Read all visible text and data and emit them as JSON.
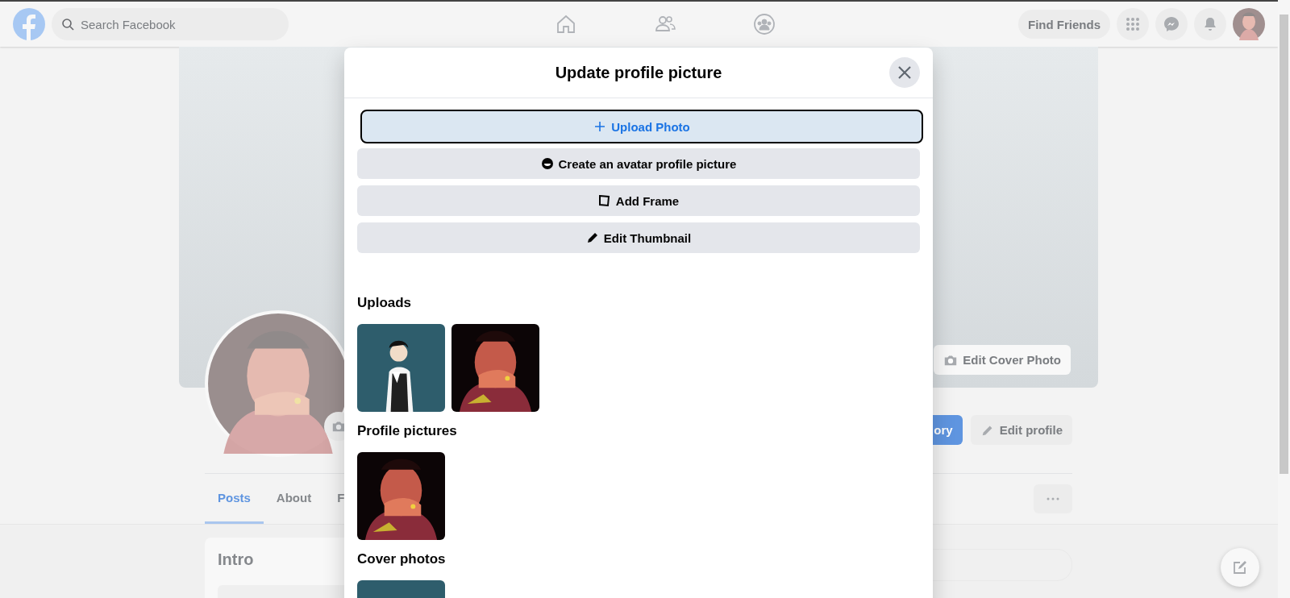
{
  "nav": {
    "search": {
      "placeholder": "Search Facebook"
    },
    "find_friends": "Find Friends"
  },
  "profile": {
    "edit_cover": "Edit Cover Photo",
    "story_button": "ory",
    "edit_profile": "Edit profile",
    "tabs": [
      {
        "label": "Posts",
        "selected": true
      },
      {
        "label": "About",
        "selected": false
      },
      {
        "label": "F",
        "selected": false
      }
    ],
    "intro": "Intro"
  },
  "dialog": {
    "title": "Update profile picture",
    "actions": [
      {
        "kind": "primary",
        "label": "Upload Photo",
        "focused": true
      },
      {
        "kind": "secondary",
        "label": "Create an avatar profile picture",
        "focused": false
      },
      {
        "kind": "secondary",
        "label": "Add Frame",
        "focused": false
      },
      {
        "kind": "secondary",
        "label": "Edit Thumbnail",
        "focused": false
      }
    ],
    "sections": [
      {
        "title": "Uploads"
      },
      {
        "title": "Profile pictures"
      },
      {
        "title": "Cover photos"
      }
    ]
  }
}
